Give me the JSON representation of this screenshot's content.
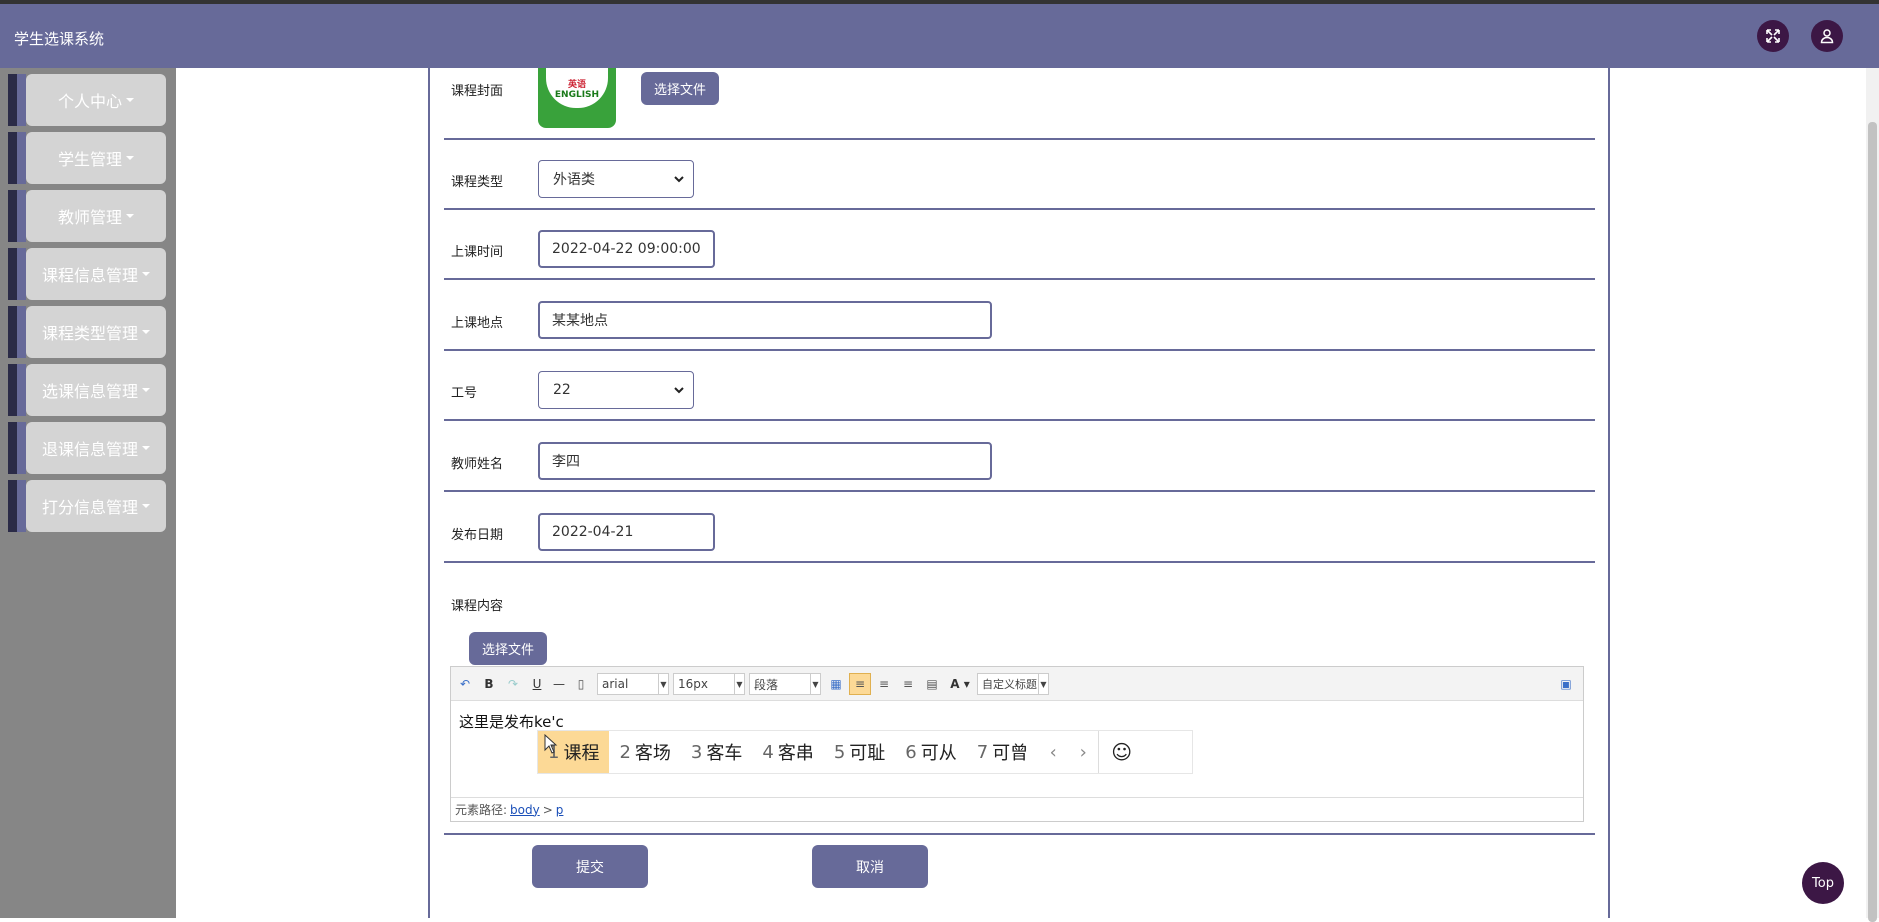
{
  "app": {
    "title": "学生选课系统"
  },
  "sidebar": {
    "items": [
      {
        "label": "个人中心"
      },
      {
        "label": "学生管理"
      },
      {
        "label": "教师管理"
      },
      {
        "label": "课程信息管理"
      },
      {
        "label": "课程类型管理"
      },
      {
        "label": "选课信息管理"
      },
      {
        "label": "退课信息管理"
      },
      {
        "label": "打分信息管理"
      }
    ]
  },
  "form": {
    "cover_label": "课程封面",
    "cover_image_text_1": "英语",
    "cover_image_text_2": "ENGLISH",
    "choose_file_label": "选择文件",
    "type_label": "课程类型",
    "type_value": "外语类",
    "time_label": "上课时间",
    "time_value": "2022-04-22 09:00:00",
    "place_label": "上课地点",
    "place_value": "某某地点",
    "job_label": "工号",
    "job_value": "22",
    "teacher_label": "教师姓名",
    "teacher_value": "李四",
    "date_label": "发布日期",
    "date_value": "2022-04-21",
    "content_label": "课程内容",
    "content_choose_file_label": "选择文件",
    "submit_label": "提交",
    "cancel_label": "取消"
  },
  "editor": {
    "font_family": "arial",
    "font_size": "16px",
    "paragraph": "段落",
    "custom_title": "自定义标题",
    "text": "这里是发布ke'c",
    "path_label": "元素路径:",
    "path_body": "body",
    "path_sep": ">",
    "path_p": "p"
  },
  "ime": {
    "candidates": [
      {
        "num": "1",
        "text": "课程"
      },
      {
        "num": "2",
        "text": "客场"
      },
      {
        "num": "3",
        "text": "客车"
      },
      {
        "num": "4",
        "text": "客串"
      },
      {
        "num": "5",
        "text": "可耻"
      },
      {
        "num": "6",
        "text": "可从"
      },
      {
        "num": "7",
        "text": "可曾"
      }
    ],
    "prev": "‹",
    "next": "›",
    "emoji": "☺"
  },
  "top_button": {
    "label": "Top"
  },
  "colors": {
    "accent": "#676a99",
    "dark": "#3c1745",
    "sidebar_bg": "#868686",
    "ime_selected": "#fcd996"
  }
}
